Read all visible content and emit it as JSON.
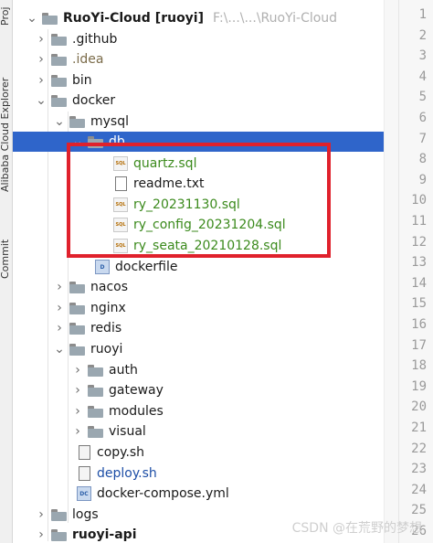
{
  "side_panel": {
    "top_label": "Proj",
    "explorer_label": "Alibaba Cloud Explorer",
    "commit_label": "Commit"
  },
  "tree": {
    "root": {
      "name": "RuoYi-Cloud",
      "module": "[ruoyi]",
      "path_hint": "F:\\...\\...\\RuoYi-Cloud"
    },
    "items": [
      {
        "name": ".github"
      },
      {
        "name": ".idea"
      },
      {
        "name": "bin"
      },
      {
        "name": "docker"
      },
      {
        "name": "mysql"
      },
      {
        "name": "db"
      },
      {
        "name": "quartz.sql"
      },
      {
        "name": "readme.txt"
      },
      {
        "name": "ry_20231130.sql"
      },
      {
        "name": "ry_config_20231204.sql"
      },
      {
        "name": "ry_seata_20210128.sql"
      },
      {
        "name": "dockerfile"
      },
      {
        "name": "nacos"
      },
      {
        "name": "nginx"
      },
      {
        "name": "redis"
      },
      {
        "name": "ruoyi"
      },
      {
        "name": "auth"
      },
      {
        "name": "gateway"
      },
      {
        "name": "modules"
      },
      {
        "name": "visual"
      },
      {
        "name": "copy.sh"
      },
      {
        "name": "deploy.sh"
      },
      {
        "name": "docker-compose.yml"
      },
      {
        "name": "logs"
      },
      {
        "name": "ruoyi-api"
      }
    ],
    "icons": {
      "sql": "SQL",
      "docker": "D",
      "compose": "DC"
    }
  },
  "gutter": {
    "line_numbers": [
      "1",
      "2",
      "3",
      "4",
      "5",
      "6",
      "7",
      "8",
      "9",
      "10",
      "11",
      "12",
      "13",
      "14",
      "15",
      "16",
      "17",
      "18",
      "19",
      "20",
      "21",
      "22",
      "23",
      "24",
      "25",
      "26"
    ]
  },
  "watermark": "CSDN @在荒野的梦想",
  "colors": {
    "selection": "#2f65ca",
    "highlight_box": "#e0212c",
    "sql_file_text": "#3b8a1c",
    "vcs_ignored": "#7b6c4a",
    "modified": "#1d4ea6"
  }
}
